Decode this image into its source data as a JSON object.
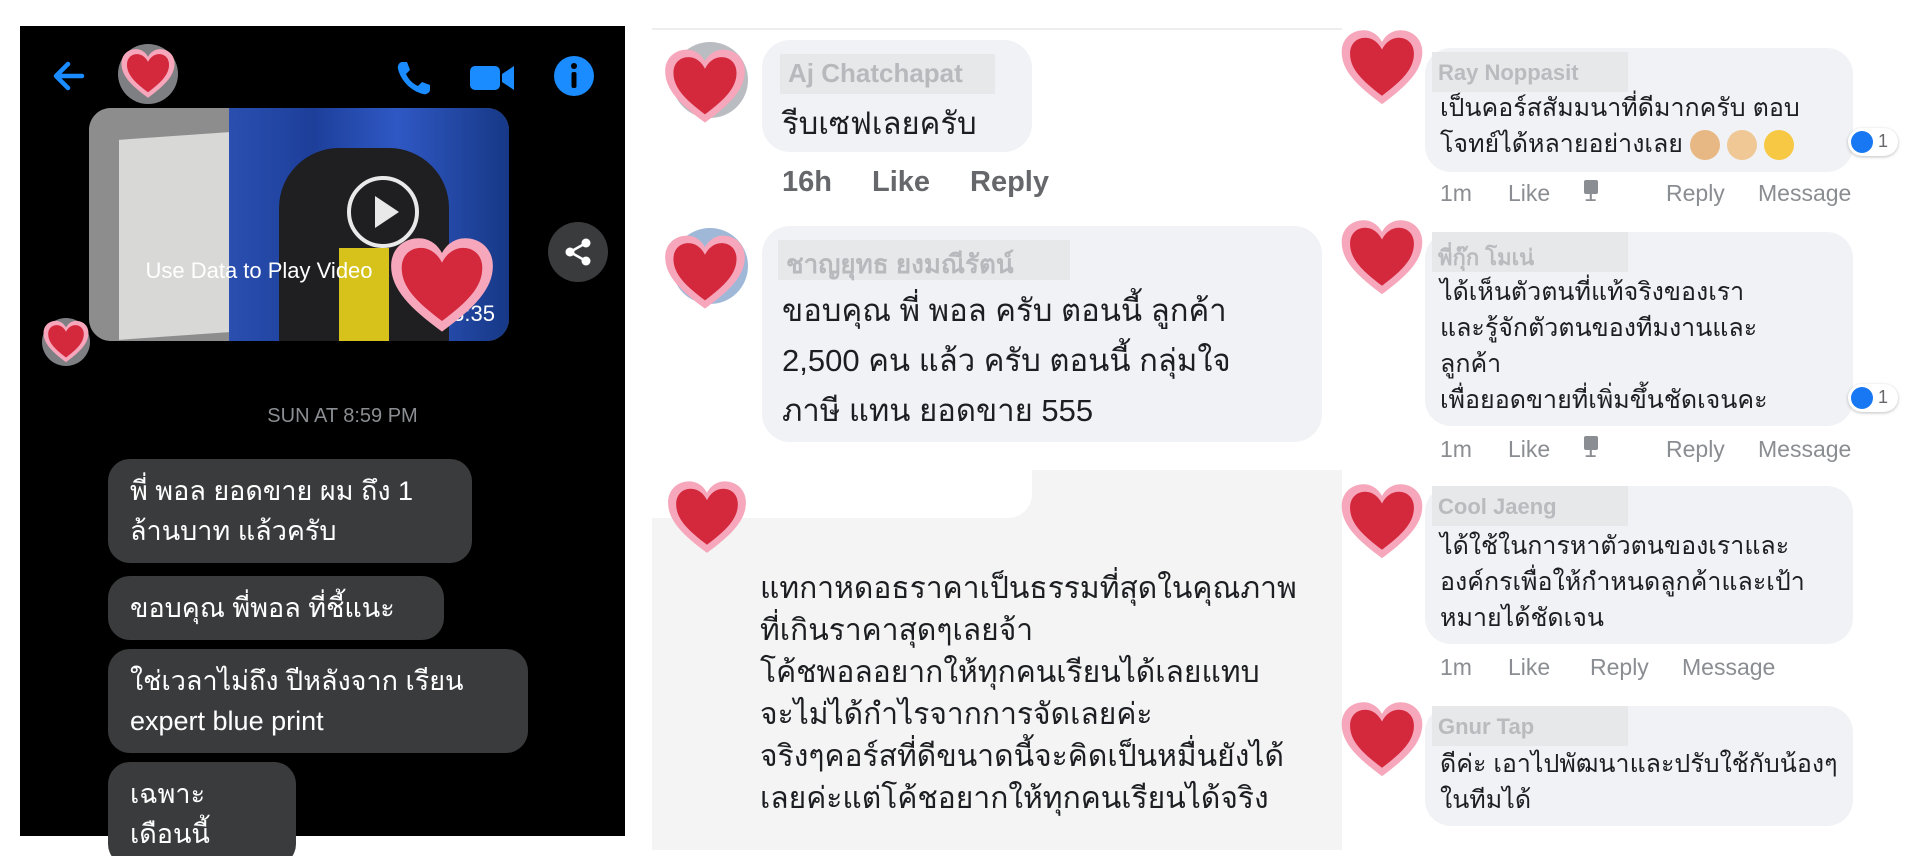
{
  "colors": {
    "messenger_bg": "#000000",
    "messenger_blue": "#1a8cff",
    "dark_bubble": "#3a3b3c",
    "light_bubble": "#f0f2f5",
    "heart_red": "#d4283c",
    "heart_pink": "#f28ca8",
    "like_blue": "#1877f2"
  },
  "messenger": {
    "icons": [
      "back-arrow-icon",
      "phone-icon",
      "video-camera-icon",
      "info-icon",
      "share-icon"
    ],
    "video": {
      "overlay_text": "Use Data to Play Video",
      "duration": "3:35"
    },
    "timestamp": "SUN AT 8:59 PM",
    "messages": [
      {
        "line1": "พี่ พอล ยอดขาย ผม ถึง 1",
        "line2": "ล้านบาท แล้วครับ"
      },
      {
        "line1": "ขอบคุณ พี่พอล ที่ชี้แนะ",
        "line2": ""
      },
      {
        "line1": "ใช่เวลาไม่ถึง ปีหลังจาก เรียน",
        "line2": "expert blue print"
      },
      {
        "line1": "เฉพาะ เดือนนี้",
        "line2": ""
      }
    ]
  },
  "middle": {
    "comment1": {
      "name": "Aj Chatchapat",
      "text": "รีบเซฟเลยครับ",
      "time": "16h",
      "like_label": "Like",
      "reply_label": "Reply"
    },
    "comment2": {
      "name": "ชาญยุทธ ยงมณีรัตน์",
      "line1": "ขอบคุณ พี่ พอล ครับ ตอนนี้ ลูกค้า",
      "line2": "2,500 คน แล้ว ครับ  ตอนนี้ กลุ่มใจ",
      "line3": "ภาษี แทน ยอดขาย 555"
    },
    "comment3": {
      "lines": [
        "แทกาหดอธราคาเป็นธรรมที่สุดในคุณภาพ",
        "ที่เกินราคาสุดๆเลยจ้า",
        "โค้ชพอลอยากให้ทุกคนเรียนได้เลยแทบ",
        "จะไม่ได้กำไรจากการจัดเลยค่ะ",
        "จริงๆคอร์สที่ดีขนาดนี้จะคิดเป็นหมื่นยังได้",
        "เลยค่ะแต่โค้ชอยากให้ทุกคนเรียนได้จริง"
      ]
    }
  },
  "right": {
    "comments": [
      {
        "name": "Ray Noppasit",
        "line1": "เป็นคอร์สสัมมนาที่ดีมากครับ ตอบ",
        "line2": "โจทย์ได้หลายอย่างเลย",
        "emojis": [
          "thumbs-up-emoji",
          "victory-hand-emoji",
          "grinning-face-emoji"
        ],
        "reactions": "1",
        "time": "1m",
        "like": "Like",
        "like_count": "1",
        "reply": "Reply",
        "message": "Message"
      },
      {
        "name": "พี่กุ๊ก โมเน่",
        "line1": "ได้เห็นตัวตนที่แท้จริงของเรา",
        "line2": "และรู้จักตัวตนของทีมงานและ",
        "line3": "ลูกค้า",
        "line4": "เพื่อยอดขายที่เพิ่มขึ้นชัดเจนคะ",
        "reactions": "1",
        "time": "1m",
        "like": "Like",
        "like_count": "1",
        "reply": "Reply",
        "message": "Message"
      },
      {
        "name": "Cool Jaeng",
        "line1": "ได้ใช้ในการหาตัวตนของเราและ",
        "line2": "องค์กรเพื่อให้กำหนดลูกค้าและเป้า",
        "line3": "หมายได้ชัดเจน",
        "time": "1m",
        "like": "Like",
        "reply": "Reply",
        "message": "Message"
      },
      {
        "name": "Gnur Tap",
        "line1": "ดีค่ะ เอาไปพัฒนาและปรับใช้กับน้องๆ",
        "line2": "ในทีมได้"
      }
    ]
  }
}
